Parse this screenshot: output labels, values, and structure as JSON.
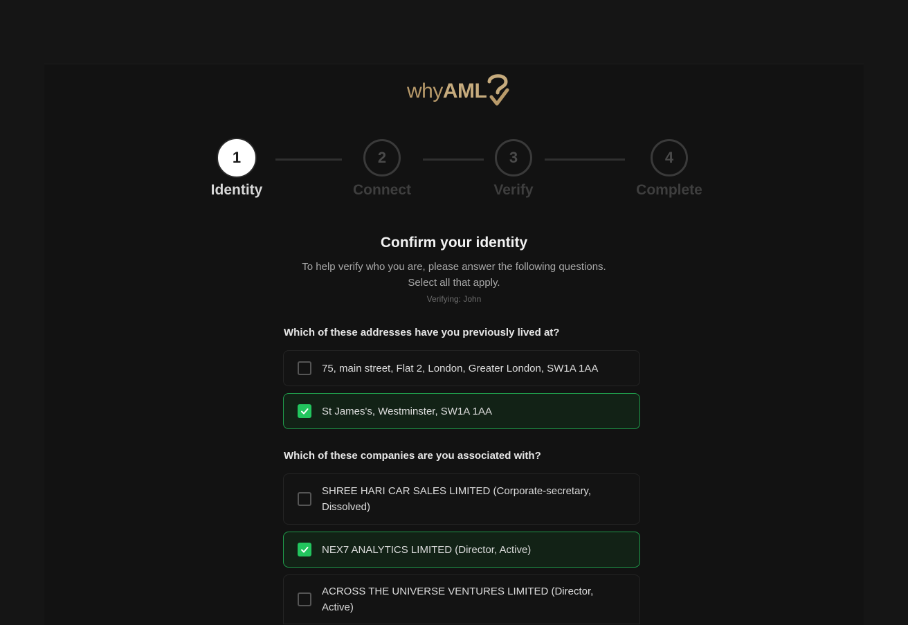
{
  "brand": {
    "why": "why",
    "aml": "AML"
  },
  "steps": [
    {
      "number": "1",
      "label": "Identity",
      "active": true
    },
    {
      "number": "2",
      "label": "Connect",
      "active": false
    },
    {
      "number": "3",
      "label": "Verify",
      "active": false
    },
    {
      "number": "4",
      "label": "Complete",
      "active": false
    }
  ],
  "heading": {
    "title": "Confirm your identity",
    "subtitle_line1": "To help verify who you are, please answer the following questions.",
    "subtitle_line2": "Select all that apply.",
    "verifying": "Verifying: John"
  },
  "questions": [
    {
      "text": "Which of these addresses have you previously lived at?",
      "options": [
        {
          "label": "75, main street, Flat 2, London, Greater London, SW1A 1AA",
          "checked": false
        },
        {
          "label": "St James's, Westminster, SW1A 1AA",
          "checked": true
        }
      ]
    },
    {
      "text": "Which of these companies are you associated with?",
      "options": [
        {
          "label": "SHREE HARI CAR SALES LIMITED (Corporate-secretary, Dissolved)",
          "checked": false
        },
        {
          "label": "NEX7 ANALYTICS LIMITED (Director, Active)",
          "checked": true
        },
        {
          "label": "ACROSS THE UNIVERSE VENTURES LIMITED (Director, Active)",
          "checked": false
        }
      ]
    }
  ],
  "colors": {
    "accent_green": "#22c55e",
    "logo_gold": "#c6ab7d",
    "background": "#121212"
  }
}
